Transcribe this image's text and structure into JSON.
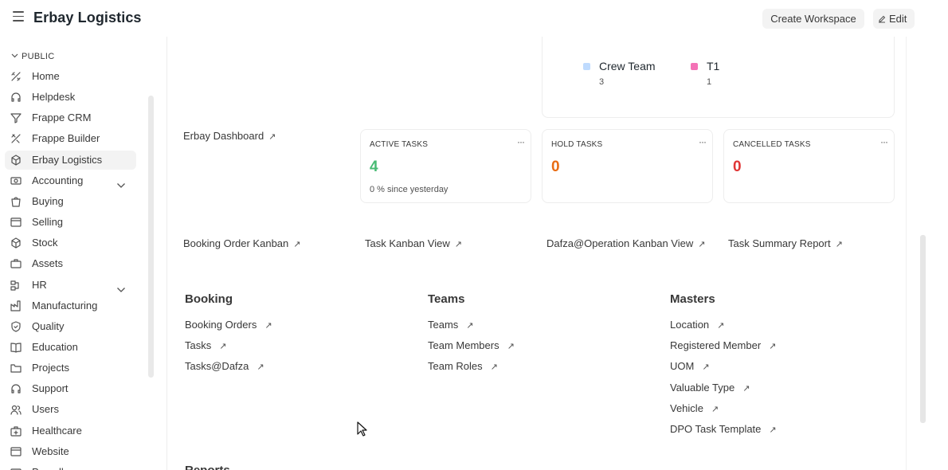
{
  "header": {
    "title": "Erbay Logistics",
    "create_workspace": "Create Workspace",
    "edit": "Edit"
  },
  "sidebar": {
    "section": "PUBLIC",
    "items": [
      {
        "label": "Home",
        "icon": "home-icon"
      },
      {
        "label": "Helpdesk",
        "icon": "headset-icon"
      },
      {
        "label": "Frappe CRM",
        "icon": "filter-icon"
      },
      {
        "label": "Frappe Builder",
        "icon": "tools-icon"
      },
      {
        "label": "Erbay Logistics",
        "icon": "cube-icon",
        "active": true
      },
      {
        "label": "Accounting",
        "icon": "money-icon",
        "expandable": true
      },
      {
        "label": "Buying",
        "icon": "shopping-bag-icon"
      },
      {
        "label": "Selling",
        "icon": "receipt-icon"
      },
      {
        "label": "Stock",
        "icon": "box-icon"
      },
      {
        "label": "Assets",
        "icon": "briefcase-icon"
      },
      {
        "label": "HR",
        "icon": "organization-icon",
        "expandable": true
      },
      {
        "label": "Manufacturing",
        "icon": "factory-icon"
      },
      {
        "label": "Quality",
        "icon": "shield-check-icon"
      },
      {
        "label": "Education",
        "icon": "book-icon"
      },
      {
        "label": "Projects",
        "icon": "folder-icon"
      },
      {
        "label": "Support",
        "icon": "headset-icon"
      },
      {
        "label": "Users",
        "icon": "users-icon"
      },
      {
        "label": "Healthcare",
        "icon": "medical-kit-icon"
      },
      {
        "label": "Website",
        "icon": "browser-icon"
      },
      {
        "label": "Payroll",
        "icon": "wallet-icon"
      }
    ]
  },
  "chart_data": {
    "type": "pie",
    "categories": [
      "Crew Team",
      "T1"
    ],
    "values": [
      3,
      1
    ],
    "colors": [
      "#bfdbfe",
      "#f472b6"
    ]
  },
  "shortcuts": {
    "dashboard": "Erbay Dashboard",
    "row": [
      "Booking Order Kanban",
      "Task Kanban View",
      "Dafza@Operation Kanban View",
      "Task Summary Report"
    ]
  },
  "number_cards": [
    {
      "title": "ACTIVE TASKS",
      "value": "4",
      "sub": "0 % since yesterday",
      "color": "#48bb74"
    },
    {
      "title": "HOLD TASKS",
      "value": "0",
      "sub": "",
      "color": "#e86c13"
    },
    {
      "title": "CANCELLED TASKS",
      "value": "0",
      "sub": "",
      "color": "#e03636"
    }
  ],
  "groups": [
    {
      "title": "Booking",
      "links": [
        "Booking Orders",
        "Tasks",
        "Tasks@Dafza"
      ]
    },
    {
      "title": "Teams",
      "links": [
        "Teams",
        "Team Members",
        "Team Roles"
      ]
    },
    {
      "title": "Masters",
      "links": [
        "Location",
        "Registered Member",
        "UOM",
        "Valuable Type",
        "Vehicle",
        "DPO Task Template"
      ]
    }
  ],
  "reports_heading": "Reports"
}
